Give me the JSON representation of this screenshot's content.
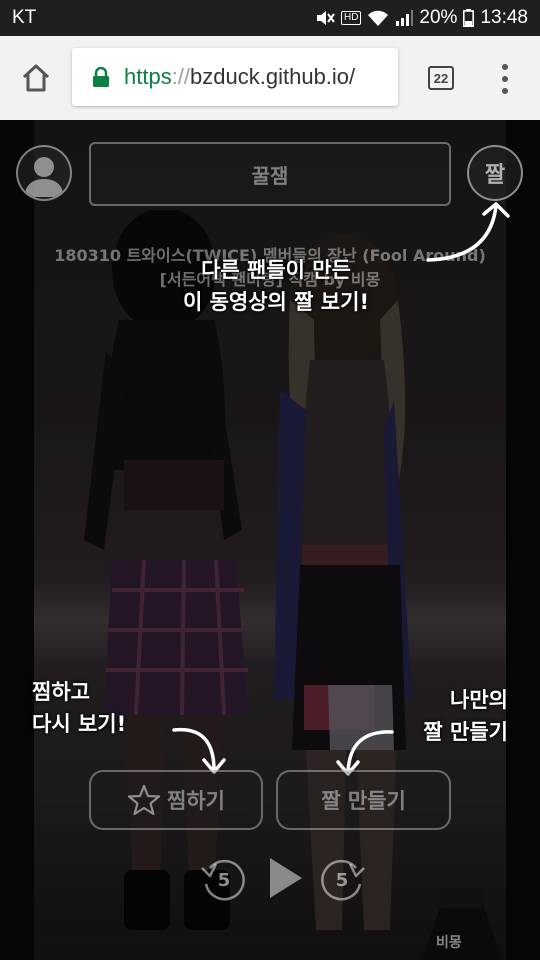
{
  "status_bar": {
    "carrier": "KT",
    "battery": "20%",
    "time": "13:48",
    "hd_label": "HD",
    "icons": [
      "mute-icon",
      "hd-icon",
      "wifi-icon",
      "signal-icon",
      "battery-icon"
    ]
  },
  "browser": {
    "url_scheme": "https",
    "url_separator": "://",
    "url_host": "bzduck.github.io/",
    "tab_count": "22",
    "icons": [
      "home-icon",
      "lock-icon",
      "tab-switcher-icon",
      "overflow-menu-icon"
    ]
  },
  "video": {
    "category_label": "꿀잼",
    "zzal_button_label": "짤",
    "title_line1": "180310 트와이스(TWICE) 멤버들의 장난 (Fool Around)",
    "title_line2": "[서든어택 팬미팅] 직캠 by 비몽",
    "watermark_text": "비몽"
  },
  "hints": {
    "top_line1": "다른 팬들이 만든",
    "top_line2": "이 동영상의 짤 보기!",
    "left_line1": "찜하고",
    "left_line2": "다시 보기!",
    "right_line1": "나만의",
    "right_line2": "짤 만들기"
  },
  "controls": {
    "favorite_label": "찜하기",
    "make_zzal_label": "짤 만들기",
    "rewind_seconds": "5",
    "forward_seconds": "5"
  },
  "colors": {
    "status_bar_bg": "#1f1f1f",
    "toolbar_bg": "#f2f2f2",
    "secure_scheme": "#0b8043",
    "video_bg": "#000000"
  }
}
